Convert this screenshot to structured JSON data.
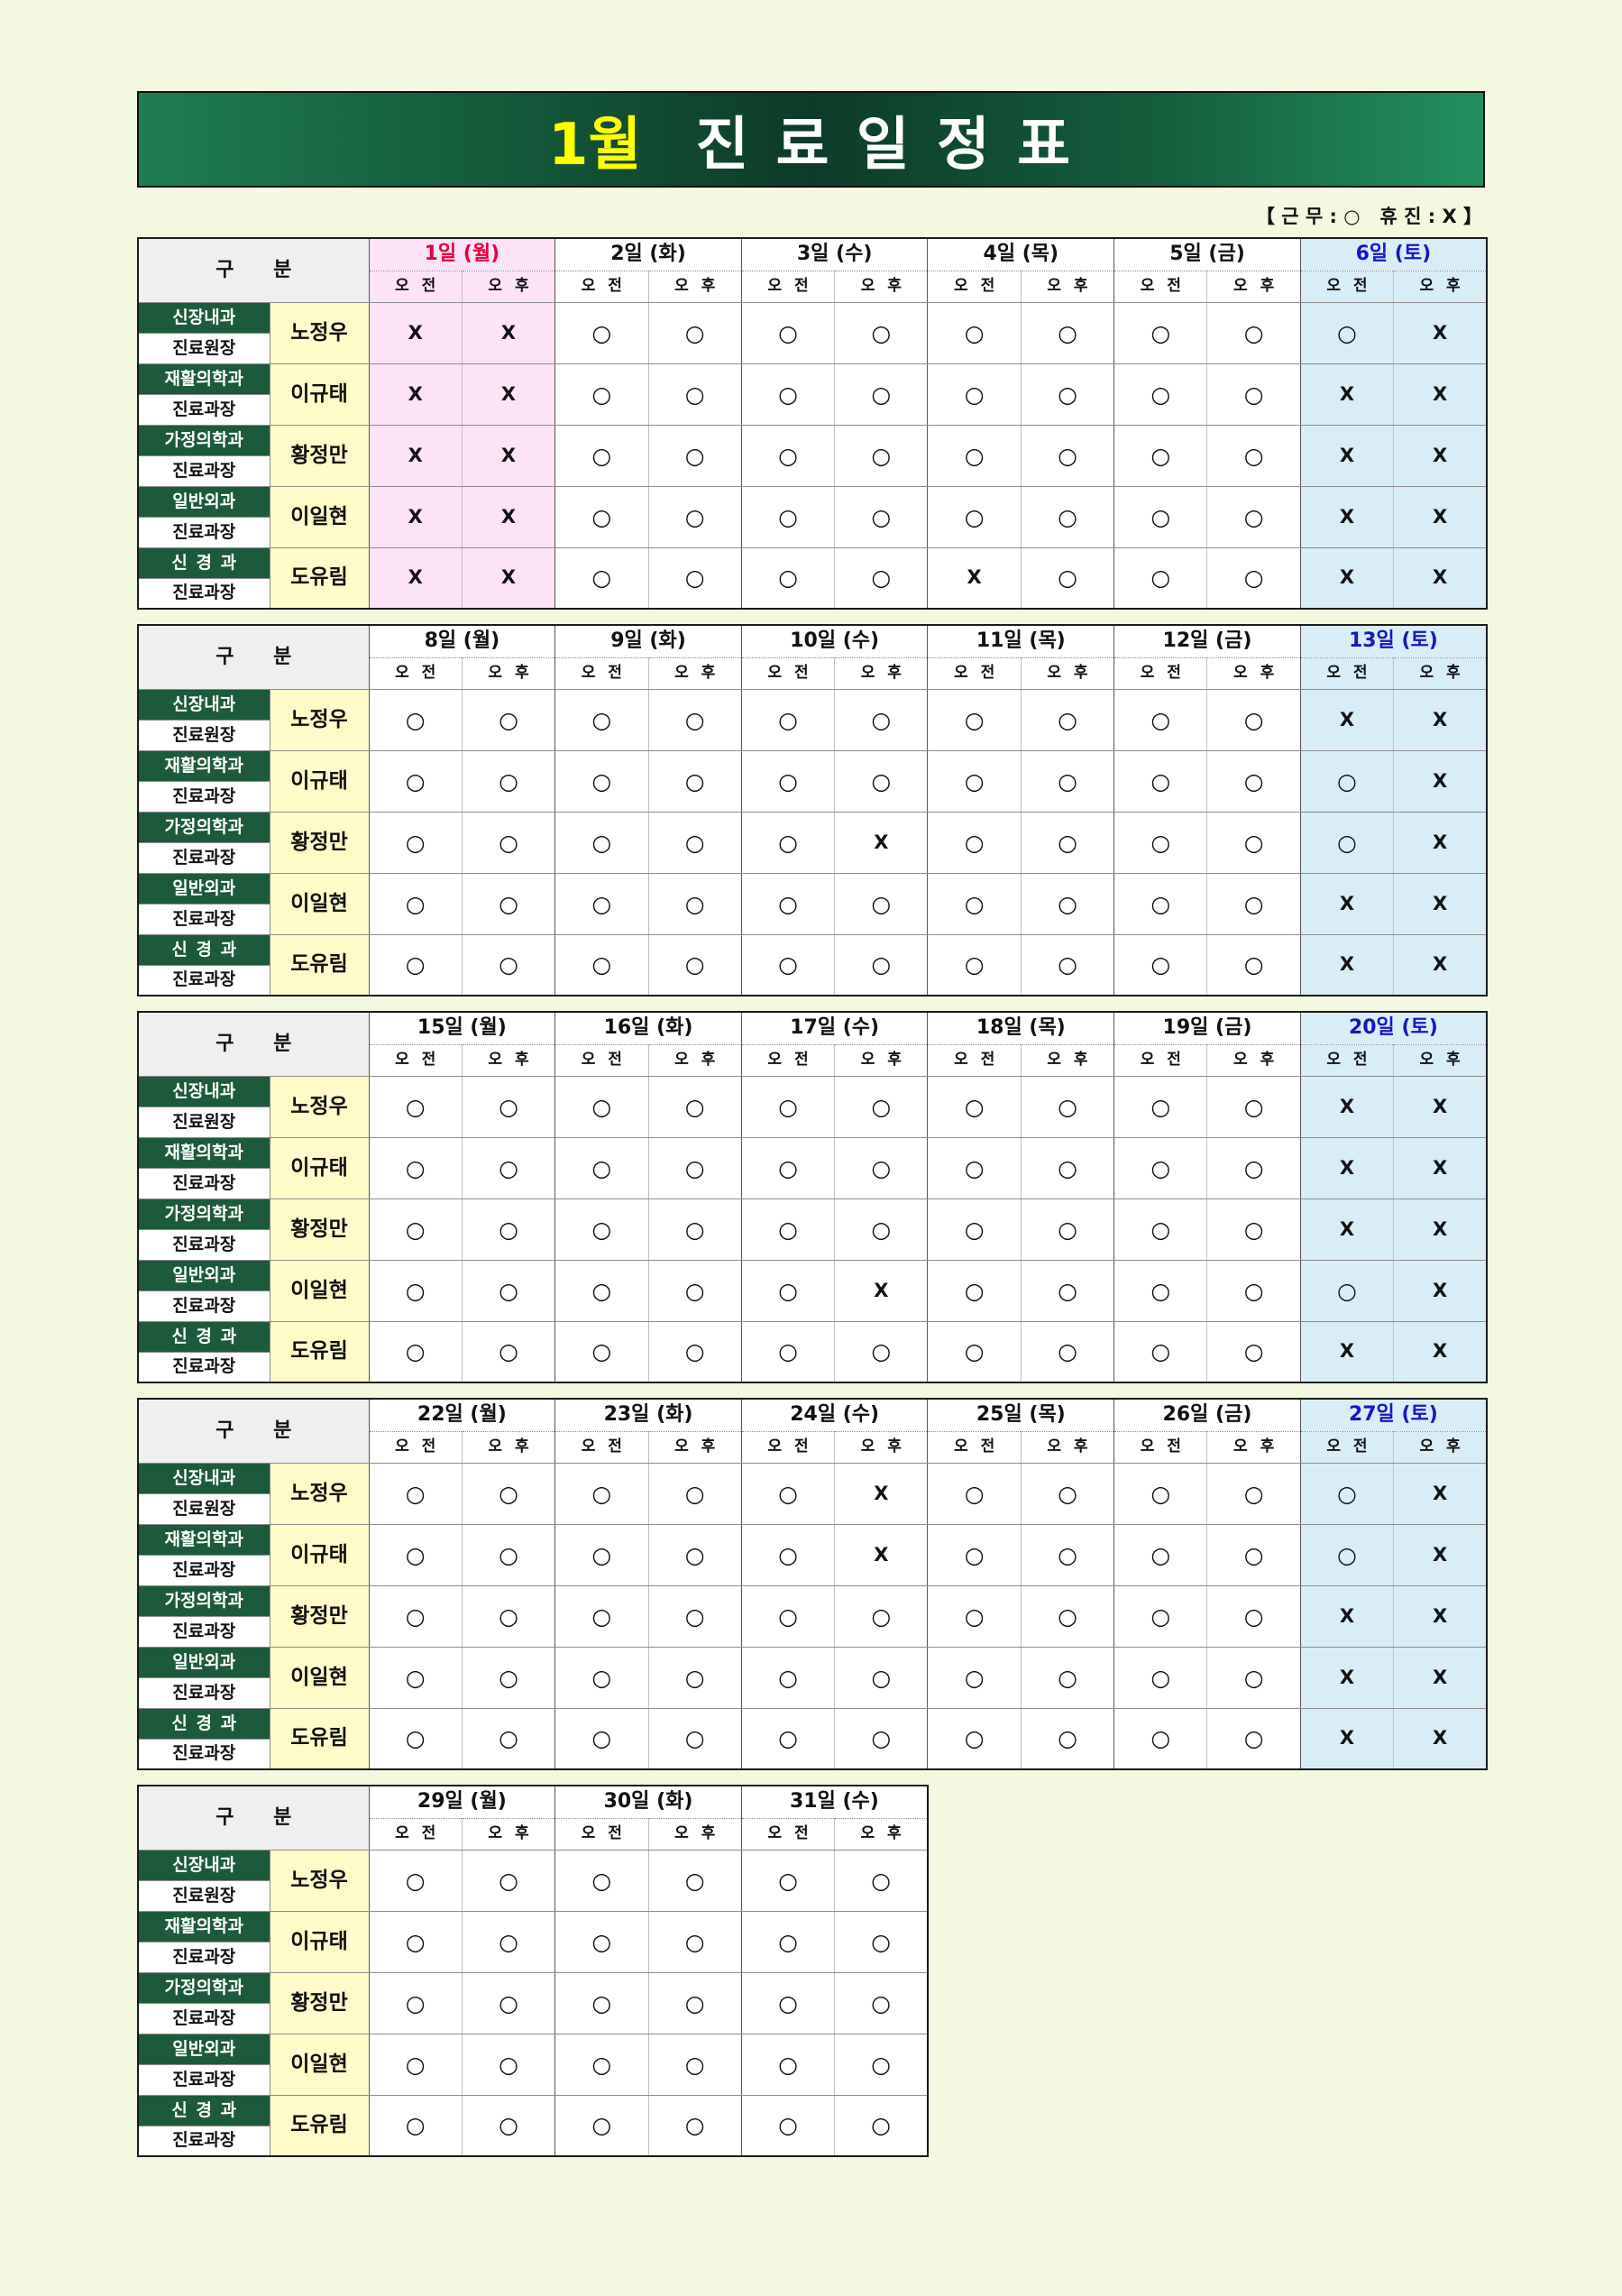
{
  "title": {
    "month": "1월",
    "text": "진 료 일 정 표"
  },
  "legend": "【 근 무 : ○   휴 진 : X 】",
  "header": {
    "category": "구 분",
    "sessions": [
      "오 전",
      "오 후"
    ]
  },
  "doctors": [
    {
      "department": "신장내과",
      "position": "진료원장",
      "name": "노정우"
    },
    {
      "department": "재활의학과",
      "position": "진료과장",
      "name": "이규태"
    },
    {
      "department": "가정의학과",
      "position": "진료과장",
      "name": "황정만"
    },
    {
      "department": "일반외과",
      "position": "진료과장",
      "name": "이일현"
    },
    {
      "department": "신 경 과",
      "position": "진료과장",
      "name": "도유림"
    }
  ],
  "colors": {
    "page_background": "#f3f9e0",
    "title_month": "#ffff00",
    "title_text": "#ffffff",
    "title_gradient": [
      "#1f7d52",
      "#0e3b29",
      "#23905f"
    ],
    "department_background": "#1d5a3b",
    "department_text": "#ffffff",
    "name_background": "#fefbc8",
    "category_background": "#efefef"
  },
  "weeks": [
    {
      "days": [
        {
          "date": "1일 (월)",
          "text_color": "#e4003c",
          "background": "#fde3f6"
        },
        {
          "date": "2일 (화)"
        },
        {
          "date": "3일 (수)"
        },
        {
          "date": "4일 (목)"
        },
        {
          "date": "5일 (금)"
        },
        {
          "date": "6일 (토)",
          "text_color": "#1717c4",
          "background": "#d9edf7"
        }
      ],
      "schedule": [
        [
          "X",
          "X",
          "○",
          "○",
          "○",
          "○",
          "○",
          "○",
          "○",
          "○",
          "○",
          "X"
        ],
        [
          "X",
          "X",
          "○",
          "○",
          "○",
          "○",
          "○",
          "○",
          "○",
          "○",
          "X",
          "X"
        ],
        [
          "X",
          "X",
          "○",
          "○",
          "○",
          "○",
          "○",
          "○",
          "○",
          "○",
          "X",
          "X"
        ],
        [
          "X",
          "X",
          "○",
          "○",
          "○",
          "○",
          "○",
          "○",
          "○",
          "○",
          "X",
          "X"
        ],
        [
          "X",
          "X",
          "○",
          "○",
          "○",
          "○",
          "X",
          "○",
          "○",
          "○",
          "X",
          "X"
        ]
      ]
    },
    {
      "days": [
        {
          "date": "8일 (월)"
        },
        {
          "date": "9일 (화)"
        },
        {
          "date": "10일 (수)"
        },
        {
          "date": "11일 (목)"
        },
        {
          "date": "12일 (금)"
        },
        {
          "date": "13일 (토)",
          "text_color": "#1717c4",
          "background": "#d9edf7"
        }
      ],
      "schedule": [
        [
          "○",
          "○",
          "○",
          "○",
          "○",
          "○",
          "○",
          "○",
          "○",
          "○",
          "X",
          "X"
        ],
        [
          "○",
          "○",
          "○",
          "○",
          "○",
          "○",
          "○",
          "○",
          "○",
          "○",
          "○",
          "X"
        ],
        [
          "○",
          "○",
          "○",
          "○",
          "○",
          "X",
          "○",
          "○",
          "○",
          "○",
          "○",
          "X"
        ],
        [
          "○",
          "○",
          "○",
          "○",
          "○",
          "○",
          "○",
          "○",
          "○",
          "○",
          "X",
          "X"
        ],
        [
          "○",
          "○",
          "○",
          "○",
          "○",
          "○",
          "○",
          "○",
          "○",
          "○",
          "X",
          "X"
        ]
      ]
    },
    {
      "days": [
        {
          "date": "15일 (월)"
        },
        {
          "date": "16일 (화)"
        },
        {
          "date": "17일 (수)"
        },
        {
          "date": "18일 (목)"
        },
        {
          "date": "19일 (금)"
        },
        {
          "date": "20일 (토)",
          "text_color": "#1717c4",
          "background": "#d9edf7"
        }
      ],
      "schedule": [
        [
          "○",
          "○",
          "○",
          "○",
          "○",
          "○",
          "○",
          "○",
          "○",
          "○",
          "X",
          "X"
        ],
        [
          "○",
          "○",
          "○",
          "○",
          "○",
          "○",
          "○",
          "○",
          "○",
          "○",
          "X",
          "X"
        ],
        [
          "○",
          "○",
          "○",
          "○",
          "○",
          "○",
          "○",
          "○",
          "○",
          "○",
          "X",
          "X"
        ],
        [
          "○",
          "○",
          "○",
          "○",
          "○",
          "X",
          "○",
          "○",
          "○",
          "○",
          "○",
          "X"
        ],
        [
          "○",
          "○",
          "○",
          "○",
          "○",
          "○",
          "○",
          "○",
          "○",
          "○",
          "X",
          "X"
        ]
      ]
    },
    {
      "days": [
        {
          "date": "22일 (월)"
        },
        {
          "date": "23일 (화)"
        },
        {
          "date": "24일 (수)"
        },
        {
          "date": "25일 (목)"
        },
        {
          "date": "26일 (금)"
        },
        {
          "date": "27일 (토)",
          "text_color": "#1717c4",
          "background": "#d9edf7"
        }
      ],
      "schedule": [
        [
          "○",
          "○",
          "○",
          "○",
          "○",
          "X",
          "○",
          "○",
          "○",
          "○",
          "○",
          "X"
        ],
        [
          "○",
          "○",
          "○",
          "○",
          "○",
          "X",
          "○",
          "○",
          "○",
          "○",
          "○",
          "X"
        ],
        [
          "○",
          "○",
          "○",
          "○",
          "○",
          "○",
          "○",
          "○",
          "○",
          "○",
          "X",
          "X"
        ],
        [
          "○",
          "○",
          "○",
          "○",
          "○",
          "○",
          "○",
          "○",
          "○",
          "○",
          "X",
          "X"
        ],
        [
          "○",
          "○",
          "○",
          "○",
          "○",
          "○",
          "○",
          "○",
          "○",
          "○",
          "X",
          "X"
        ]
      ]
    },
    {
      "days": [
        {
          "date": "29일 (월)"
        },
        {
          "date": "30일 (화)"
        },
        {
          "date": "31일 (수)"
        }
      ],
      "schedule": [
        [
          "○",
          "○",
          "○",
          "○",
          "○",
          "○"
        ],
        [
          "○",
          "○",
          "○",
          "○",
          "○",
          "○"
        ],
        [
          "○",
          "○",
          "○",
          "○",
          "○",
          "○"
        ],
        [
          "○",
          "○",
          "○",
          "○",
          "○",
          "○"
        ],
        [
          "○",
          "○",
          "○",
          "○",
          "○",
          "○"
        ]
      ]
    }
  ]
}
